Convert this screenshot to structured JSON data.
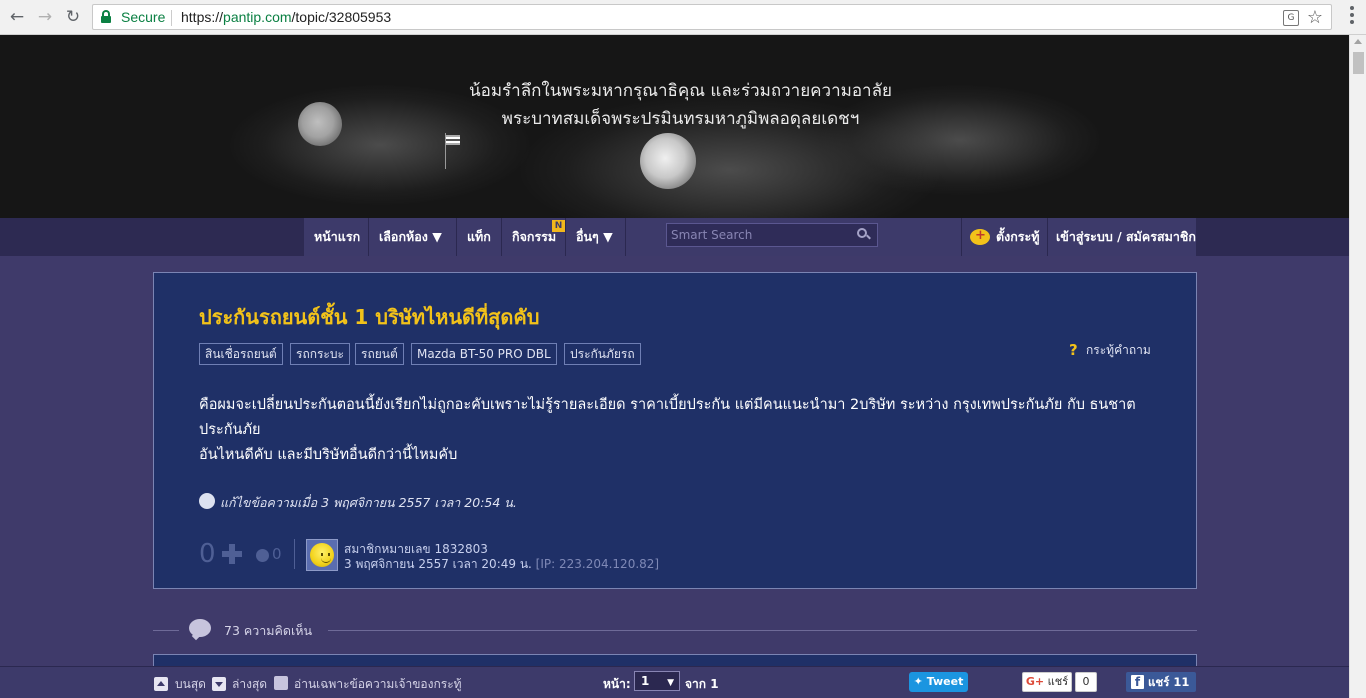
{
  "browser": {
    "secure_label": "Secure",
    "url_prefix": "https://",
    "url_host": "pantip.com",
    "url_path": "/topic/32805953"
  },
  "banner": {
    "line1": "น้อมรำลึกในพระมหากรุณาธิคุณ และร่วมถวายความอาลัย",
    "line2": "พระบาทสมเด็จพระปรมินทรมหาภูมิพลอดุลยเดชฯ"
  },
  "nav": {
    "home": "หน้าแรก",
    "rooms": "เลือกห้อง ▼",
    "tags": "แท็ก",
    "activities": "กิจกรรม",
    "activities_badge": "N",
    "more": "อื่นๆ ▼",
    "search_placeholder": "Smart Search",
    "create_topic": "ตั้งกระทู้",
    "login": "เข้าสู่ระบบ / สมัครสมาชิก"
  },
  "topic": {
    "title": "ประกันรถยนต์ชั้น 1 บริษัทไหนดีที่สุดคับ",
    "tags": [
      "สินเชื่อรถยนต์",
      "รถกระบะ",
      "รถยนต์",
      "Mazda BT-50 PRO DBL",
      "ประกันภัยรถ"
    ],
    "type_label": "กระทู้คำถาม",
    "body_line1": "คือผมจะเปลี่ยนประกันตอนนี้ยังเรียกไม่ถูกอะคับเพราะไม่รู้รายละเอียด ราคาเบี้ยประกัน แต่มีคนแนะนำมา 2บริษัท ระหว่าง กรุงเทพประกันภัย กับ ธนชาตประกันภัย",
    "body_line2": "อันไหนดีคับ และมีบริษัทอื่นดีกว่านี้ไหมคับ",
    "edit_note": "แก้ไขข้อความเมื่อ 3 พฤศจิกายน 2557 เวลา 20:54 น.",
    "vote_count": "0",
    "emotion_count": "0",
    "member": "สมาชิกหมายเลข 1832803",
    "posted_at": "3 พฤศจิกายน 2557 เวลา 20:49 น.",
    "ip": "[IP: 223.204.120.82]"
  },
  "comments": {
    "count_label": "73 ความคิดเห็น"
  },
  "bottombar": {
    "to_top": "บนสุด",
    "to_bottom": "ล่างสุด",
    "owner_only": "อ่านเฉพาะข้อความเจ้าของกระทู้",
    "page_label": "หน้า:",
    "page_value": "1",
    "page_of": "จาก 1",
    "tweet": "Tweet",
    "gplus_share": "แชร์",
    "gplus_count": "0",
    "fb_share": "แชร์ 11"
  }
}
